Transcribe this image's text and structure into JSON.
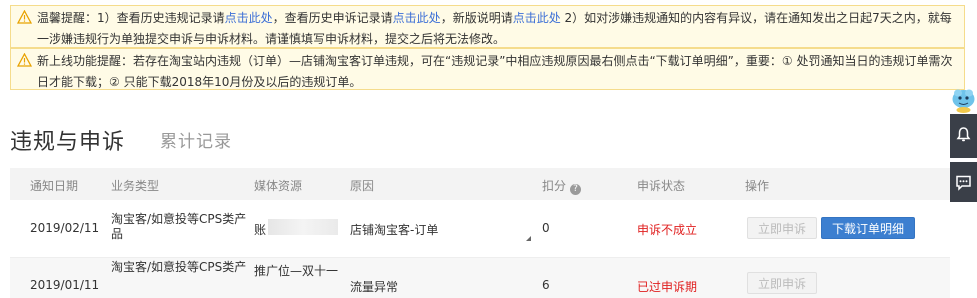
{
  "notice1": {
    "lead": "温馨提醒：1）查看历史违规记录请",
    "link1": "点击此处",
    "mid1": "，查看历史申诉记录请",
    "link2": "点击此处",
    "mid2": "，新版说明请",
    "link3": "点击此处",
    "tail": " 2）如对涉嫌违规通知的内容有异议，请在通知发出之日起7天之内，就每一涉嫌违规行为单独提交申诉与申诉材料。请谨慎填写申诉材料，提交之后将无法修改。"
  },
  "notice2": {
    "text": "新上线功能提醒：若存在淘宝站内违规（订单）—店铺淘宝客订单违规，可在“违规记录”中相应违规原因最右侧点击“下载订单明细”，重要：① 处罚通知当日的违规订单需次日才能下载；② 只能下载2018年10月份及以后的违规订单。"
  },
  "page": {
    "title": "违规与申诉",
    "tab_history": "累计记录"
  },
  "table": {
    "headers": {
      "date": "通知日期",
      "type": "业务类型",
      "media": "媒体资源",
      "reason": "原因",
      "points": "扣分",
      "appeal_status": "申诉状态",
      "action": "操作"
    },
    "rows": [
      {
        "date": "2019/02/11",
        "type": "淘宝客/如意投等CPS类产品",
        "media": "账",
        "reason": "店铺淘宝客-订单",
        "points": "0",
        "status": "申诉不成立",
        "btn_appeal": "立即申诉",
        "btn_download": "下载订单明细"
      },
      {
        "date": "2019/01/11",
        "type": "淘宝客/如意投等CPS类产",
        "media": "推广位—双十一",
        "reason": "流量异常",
        "points": "6",
        "status": "已过申诉期",
        "btn_appeal": "立即申诉"
      }
    ]
  },
  "colors": {
    "accent": "#3c7fd0",
    "warning_bg": "#fffbe6",
    "status_red": "#e02020"
  },
  "icons": [
    "warning-icon",
    "help-icon",
    "mascot-icon",
    "bell-icon",
    "chat-icon"
  ]
}
